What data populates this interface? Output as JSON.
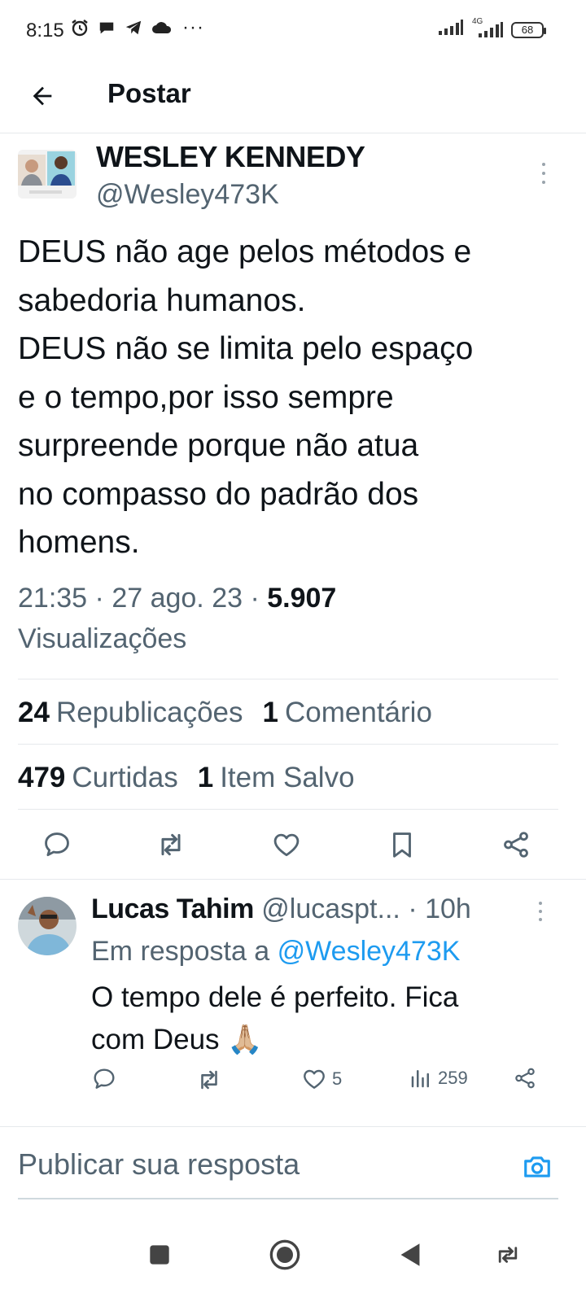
{
  "status_bar": {
    "time": "8:15",
    "more": "···",
    "network": "4G",
    "battery": "68"
  },
  "header": {
    "title": "Postar"
  },
  "tweet": {
    "author_name": "WESLEY KENNEDY",
    "author_handle": "@Wesley473K",
    "lines": [
      "DEUS não age pelos métodos e",
      "sabedoria humanos.",
      "DEUS não se limita pelo espaço",
      "e o tempo,por isso sempre",
      "surpreende porque não atua",
      "no compasso do padrão dos",
      "homens."
    ],
    "time": "21:35",
    "date": "27 ago. 23",
    "views_count": "5.907",
    "views_label": "Visualizações",
    "stats": {
      "reposts_count": "24",
      "reposts_label": "Republicações",
      "comments_count": "1",
      "comments_label": "Comentário",
      "likes_count": "479",
      "likes_label": "Curtidas",
      "saved_count": "1",
      "saved_label": "Item Salvo"
    }
  },
  "reply": {
    "author_name": "Lucas Tahim",
    "author_handle": "@lucaspt...",
    "time": "10h",
    "reply_to_prefix": "Em resposta a",
    "reply_to_handle": "@Wesley473K",
    "text_line1": "O tempo dele é perfeito. Fica",
    "text_line2": "com Deus 🙏🏼",
    "likes": "5",
    "views": "259"
  },
  "compose": {
    "placeholder": "Publicar sua resposta"
  },
  "colors": {
    "accent": "#1d9bf0",
    "text_primary": "#0f1419",
    "text_secondary": "#536471",
    "divider": "#e6e9ec"
  },
  "icons": {
    "back": "arrow-left-icon",
    "more": "more-vertical-icon",
    "reply": "comment-icon",
    "repost": "repost-icon",
    "like": "heart-icon",
    "bookmark": "bookmark-icon",
    "share": "share-icon",
    "views": "bar-chart-icon",
    "camera": "camera-icon"
  }
}
